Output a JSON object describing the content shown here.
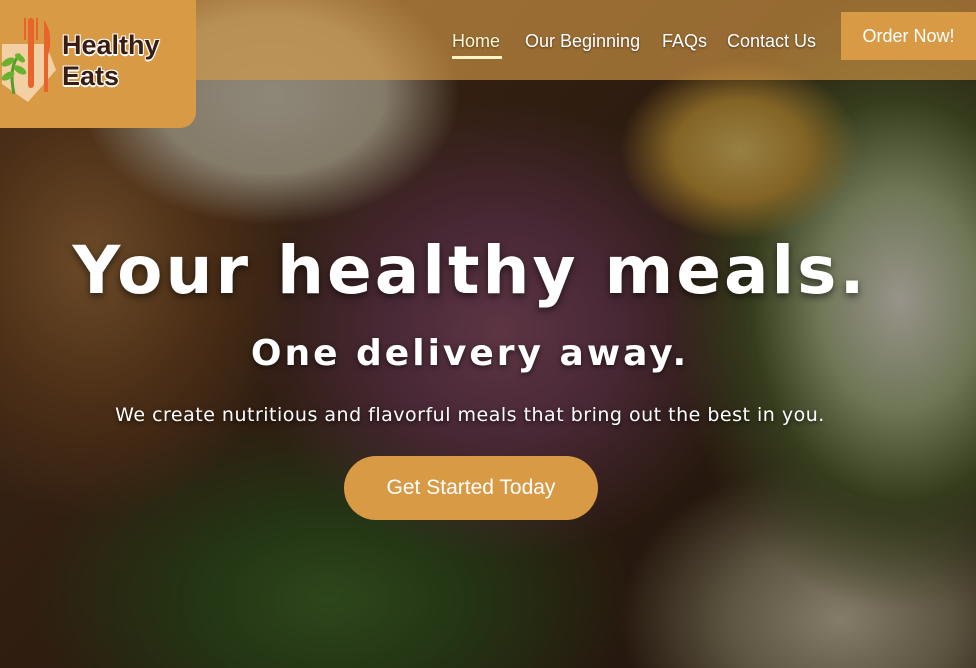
{
  "brand": {
    "line1": "Healthy",
    "line2": "Eats",
    "icon": "fork-knife-leaf-icon",
    "color": "#d99a45"
  },
  "nav": {
    "items": [
      {
        "label": "Home",
        "active": true
      },
      {
        "label": "Our Beginning",
        "active": false
      },
      {
        "label": "FAQs",
        "active": false
      },
      {
        "label": "Contact Us",
        "active": false
      }
    ],
    "cta": "Order Now!"
  },
  "hero": {
    "headline": "Your healthy meals.",
    "subheadline": "One delivery away.",
    "tagline": "We create nutritious and flavorful meals that bring out the best in you.",
    "button": "Get Started Today",
    "background": "food-spread-photo"
  },
  "colors": {
    "accent": "#d99a45",
    "text": "#ffffff",
    "brand_text": "#3a1d12"
  }
}
